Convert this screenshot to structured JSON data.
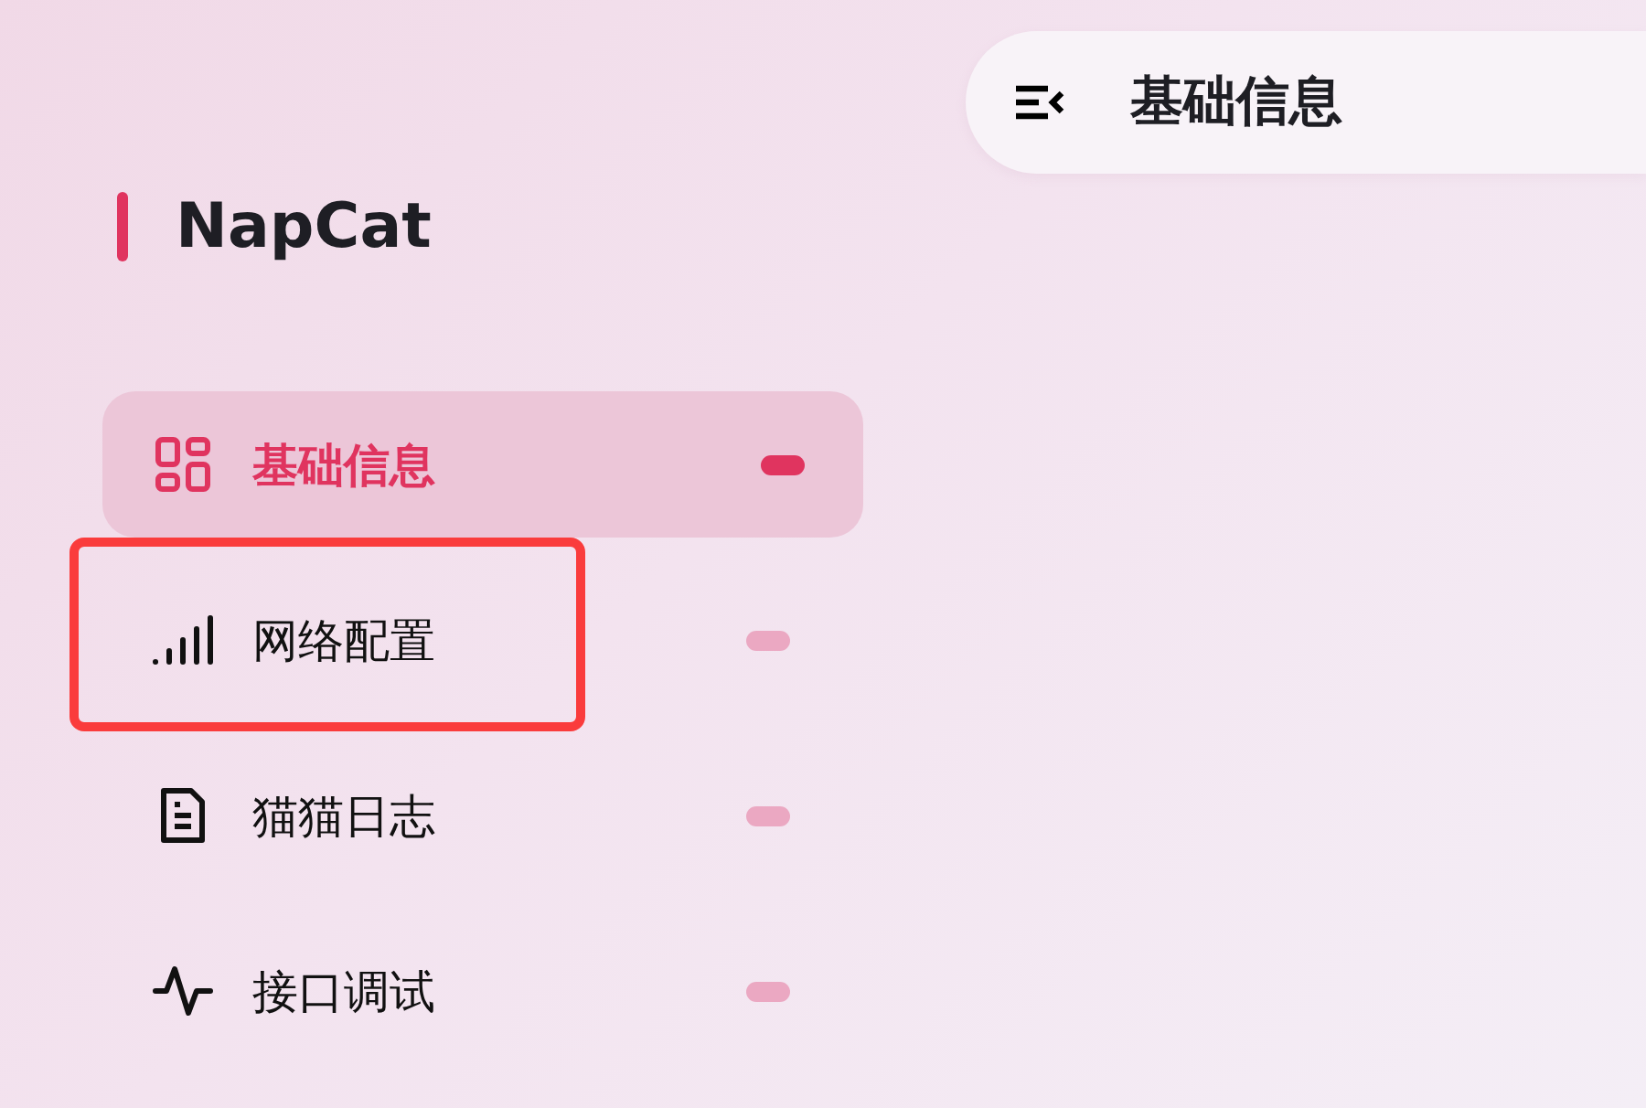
{
  "sidebar": {
    "brand": "NapCat",
    "items": [
      {
        "label": "基础信息",
        "kind": "grid",
        "selected": true,
        "highlighted": false
      },
      {
        "label": "网络配置",
        "kind": "signal",
        "selected": false,
        "highlighted": true
      },
      {
        "label": "猫猫日志",
        "kind": "document",
        "selected": false,
        "highlighted": false
      },
      {
        "label": "接口调试",
        "kind": "pulse",
        "selected": false,
        "highlighted": false
      }
    ]
  },
  "header": {
    "title": "基础信息"
  }
}
